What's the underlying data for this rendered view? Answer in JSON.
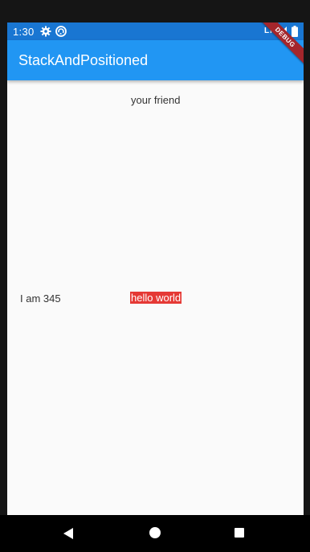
{
  "status_bar": {
    "time": "1:30",
    "network": "LTE",
    "icons": [
      "settings-icon",
      "sync-icon",
      "signal-icon",
      "battery-icon"
    ],
    "color": "#1976d2"
  },
  "app_bar": {
    "title": "StackAndPositioned",
    "color": "#2196f3",
    "banner": "DEBUG"
  },
  "body": {
    "top_text": "your friend",
    "left_text": "I am 345",
    "highlight_text": "hello world",
    "highlight_color": "#e53935",
    "background": "#fafafa"
  },
  "nav_bar": {
    "buttons": [
      "back-icon",
      "home-icon",
      "recents-icon"
    ]
  }
}
